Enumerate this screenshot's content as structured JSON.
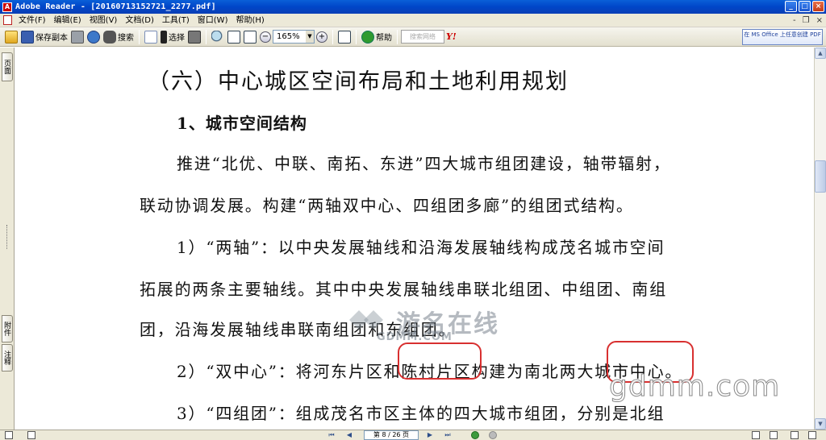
{
  "window": {
    "title": "Adobe Reader - [20160713152721_2277.pdf]",
    "icon_label": "A",
    "controls": [
      "_",
      "□",
      "×"
    ]
  },
  "menu": {
    "items": [
      "文件(F)",
      "编辑(E)",
      "视图(V)",
      "文档(D)",
      "工具(T)",
      "窗口(W)",
      "帮助(H)"
    ],
    "right_controls": [
      "-",
      "❐",
      "×"
    ]
  },
  "toolbar": {
    "save_copy_label": "保存副本",
    "search_label": "搜索",
    "select_label": "选择",
    "zoom_value": "165%",
    "help_label": "帮助",
    "search_placeholder": "搜索网络",
    "yahoo_label": "Y!",
    "ms_office_text": "在 MS Office 上任意创建 PDF"
  },
  "navpane": {
    "top_tab": "页面",
    "attach_tab": "附件",
    "comments_tab": "注释"
  },
  "document": {
    "heading": "（六）中心城区空间布局和土地利用规划",
    "subheading": "1、城市空间结构",
    "lines": [
      "推进“北优、中联、南拓、东进”四大城市组团建设，轴带辐射，",
      "联动协调发展。构建“两轴双中心、四组团多廊”的组团式结构。",
      "1）“两轴”：以中央发展轴线和沿海发展轴线构成茂名城市空间",
      "拓展的两条主要轴线。其中中央发展轴线串联北组团、中组团、南组",
      "团，沿海发展轴线串联南组团和东组团。",
      "2）“双中心”：将河东片区和陈村片区构建为南北两大城市中心。",
      "3）“四组团”：组成茂名市区主体的四大城市组团，分别是北组"
    ]
  },
  "watermarks": {
    "site_cn": "游名在线",
    "site_domain": "GDMM.COM",
    "site_url": "gdmm.com"
  },
  "statusbar": {
    "page_indicator": "第 8 / 26 页"
  }
}
